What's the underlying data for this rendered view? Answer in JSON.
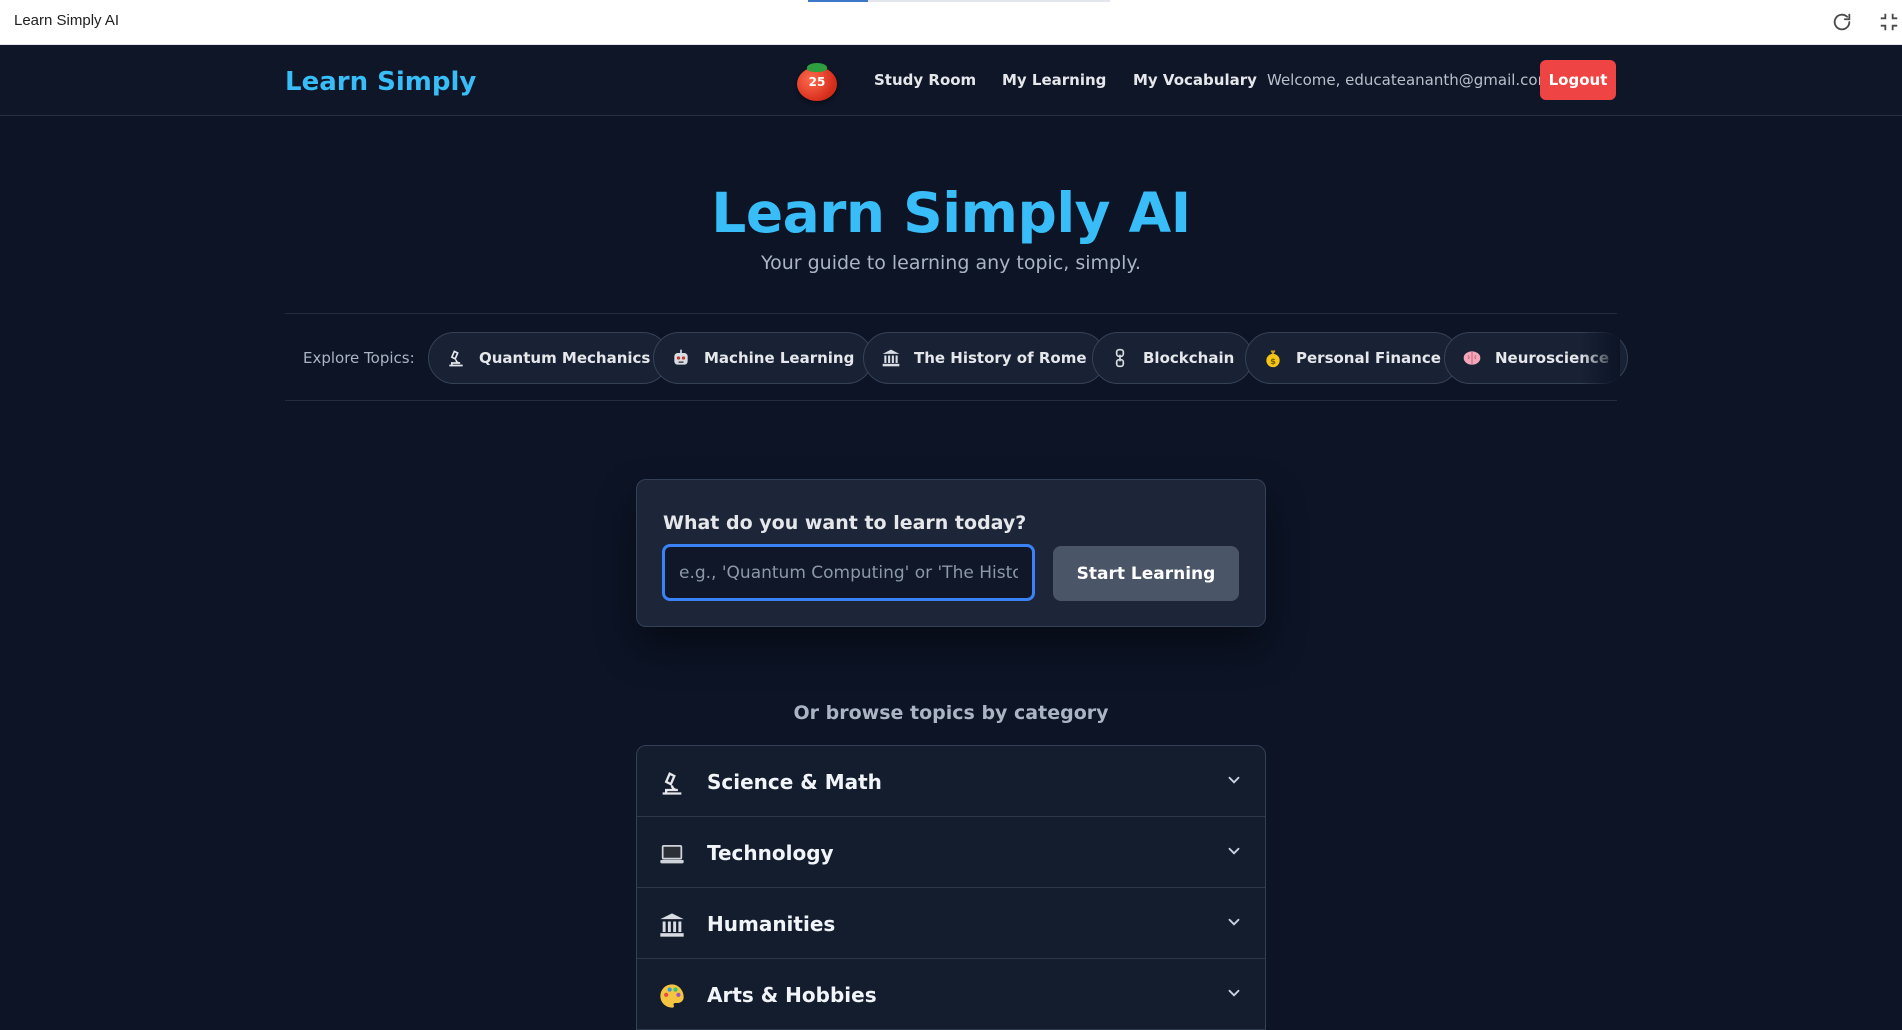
{
  "browser": {
    "title": "Learn Simply AI",
    "reload_icon": "reload-icon",
    "fullscreen_icon": "exit-fullscreen-icon"
  },
  "header": {
    "brand": "Learn Simply",
    "timer_value": "25",
    "nav": [
      "Study Room",
      "My Learning",
      "My Vocabulary"
    ],
    "welcome": "Welcome, educateananth@gmail.com",
    "logout": "Logout"
  },
  "hero": {
    "title": "Learn Simply AI",
    "subtitle": "Your guide to learning any topic, simply."
  },
  "topics": {
    "label": "Explore Topics:",
    "chips": [
      {
        "label": "Quantum Mechanics",
        "icon": "microscope-icon"
      },
      {
        "label": "Machine Learning",
        "icon": "robot-icon"
      },
      {
        "label": "The History of Rome",
        "icon": "classical-building-icon"
      },
      {
        "label": "Blockchain",
        "icon": "chain-link-icon"
      },
      {
        "label": "Personal Finance",
        "icon": "money-bag-icon"
      },
      {
        "label": "Neuroscience",
        "icon": "brain-icon"
      }
    ]
  },
  "search": {
    "label": "What do you want to learn today?",
    "placeholder": "e.g., 'Quantum Computing' or 'The History of Rome'",
    "value": "",
    "button": "Start Learning"
  },
  "categories": {
    "heading": "Or browse topics by category",
    "items": [
      {
        "label": "Science & Math",
        "icon": "microscope-icon"
      },
      {
        "label": "Technology",
        "icon": "laptop-icon"
      },
      {
        "label": "Humanities",
        "icon": "classical-building-icon"
      },
      {
        "label": "Arts & Hobbies",
        "icon": "artist-palette-icon"
      }
    ]
  },
  "colors": {
    "accent": "#38bdf8",
    "background": "#0c1426",
    "logout": "#ef4444",
    "input_focus": "#3b82f6"
  }
}
